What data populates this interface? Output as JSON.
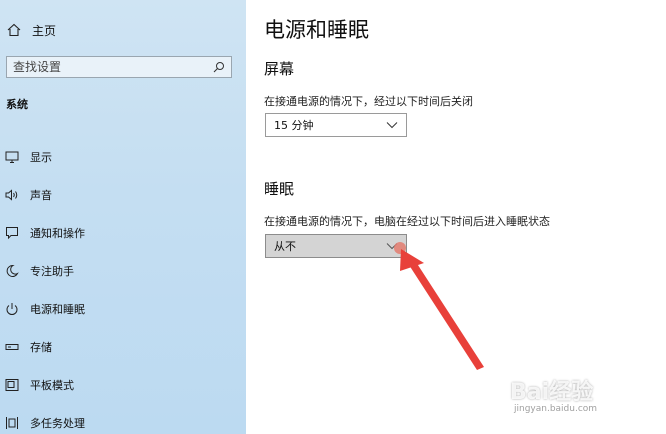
{
  "sidebar": {
    "home_label": "主页",
    "search_placeholder": "查找设置",
    "section_label": "系统",
    "items": [
      {
        "label": "显示",
        "icon": "monitor-icon"
      },
      {
        "label": "声音",
        "icon": "speaker-icon"
      },
      {
        "label": "通知和操作",
        "icon": "notification-icon"
      },
      {
        "label": "专注助手",
        "icon": "moon-icon"
      },
      {
        "label": "电源和睡眠",
        "icon": "power-icon"
      },
      {
        "label": "存储",
        "icon": "storage-icon"
      },
      {
        "label": "平板模式",
        "icon": "tablet-icon"
      },
      {
        "label": "多任务处理",
        "icon": "multitask-icon"
      }
    ]
  },
  "main": {
    "title": "电源和睡眠",
    "screen": {
      "heading": "屏幕",
      "description": "在接通电源的情况下，经过以下时间后关闭",
      "selected": "15 分钟"
    },
    "sleep": {
      "heading": "睡眠",
      "description": "在接通电源的情况下，电脑在经过以下时间后进入睡眠状态",
      "selected": "从不"
    }
  },
  "watermark": {
    "brand": "Bai经验",
    "url": "jingyan.baidu.com"
  },
  "colors": {
    "sidebar_bg": "#c4def2",
    "arrow": "#e8403a",
    "active_dropdown": "#d4d4d4"
  }
}
